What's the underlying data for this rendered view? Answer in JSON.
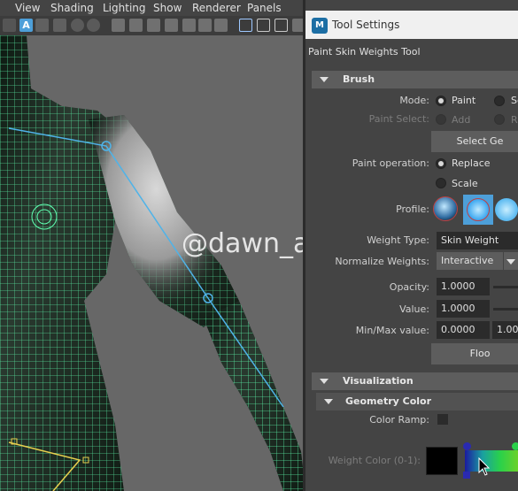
{
  "menubar": {
    "items": [
      "View",
      "Shading",
      "Lighting",
      "Show",
      "Renderer",
      "Panels"
    ]
  },
  "watermark": "@dawn_arc",
  "tool_settings": {
    "window_title": "Tool Settings",
    "tool_name": "Paint Skin Weights Tool",
    "brush": {
      "section_label": "Brush",
      "mode_label": "Mode:",
      "mode_options": [
        "Paint",
        "Se"
      ],
      "mode_selected": "Paint",
      "paint_select_label": "Paint Select:",
      "paint_select_options": [
        "Add",
        "R"
      ],
      "select_geometry_button": "Select Ge",
      "paint_operation_label": "Paint operation:",
      "paint_operation_options": [
        "Replace",
        "Scale"
      ],
      "paint_operation_selected": "Replace",
      "profile_label": "Profile:",
      "weight_type_label": "Weight Type:",
      "weight_type_value": "Skin Weight",
      "normalize_label": "Normalize Weights:",
      "normalize_value": "Interactive",
      "opacity_label": "Opacity:",
      "opacity_value": "1.0000",
      "value_label": "Value:",
      "value_value": "1.0000",
      "minmax_label": "Min/Max value:",
      "min_value": "0.0000",
      "max_value": "1.000",
      "flood_button": "Floo"
    },
    "visualization": {
      "section_label": "Visualization",
      "geometry_color_label": "Geometry Color",
      "color_ramp_label": "Color Ramp:",
      "weight_color_label": "Weight Color (0-1):",
      "weight_color": "#000000"
    }
  },
  "colors": {
    "accent": "#4d9fd9",
    "wireframe": "#5fffb0",
    "bone": "#4fb3e8"
  }
}
